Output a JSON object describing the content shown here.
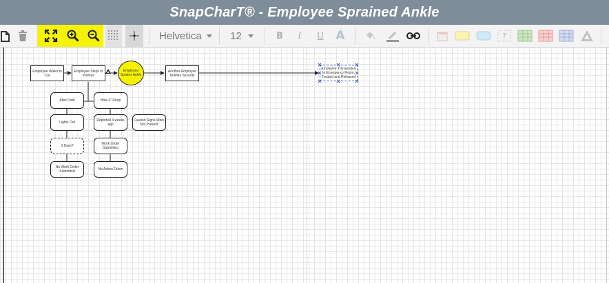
{
  "app": {
    "title": "SnapCharT® - Employee Sprained Ankle"
  },
  "toolbar": {
    "font_family": "Helvetica",
    "font_size": "12",
    "bold_label": "B",
    "italic_label": "I",
    "underline_label": "U",
    "text_style_label": "A",
    "highlight_color": "#f4f400"
  },
  "nodes": {
    "employee_walks_to_car": "Employee Walks to Car",
    "employee_steps_in_pothole": "Employee Steps in Pothole",
    "employee_sprains_ankle": "Employee Sprains Ankle",
    "another_employee_notifies_security": "Another Employee Notifies Security",
    "employee_transported": "Employee Transported to Emergency Room, Treated and Released",
    "after_dark": "After Dark",
    "hole_deep": "Hole 4\" Deep",
    "lights_out": "Lights Out",
    "reported_4_weeks_ago": "Reported 4 weeks ago",
    "caution_signs_not_present": "Caution Signs Were Not Present",
    "three_days": "3 Days?",
    "work_order_submitted": "Work Order Submitted",
    "no_work_order_submitted": "No Work Order Submitted",
    "no_action_taken": "No Action Taken"
  },
  "colors": {
    "title_bar": "#7f8c99",
    "incident_fill": "#f5f200",
    "selection": "#3b5bd6"
  }
}
